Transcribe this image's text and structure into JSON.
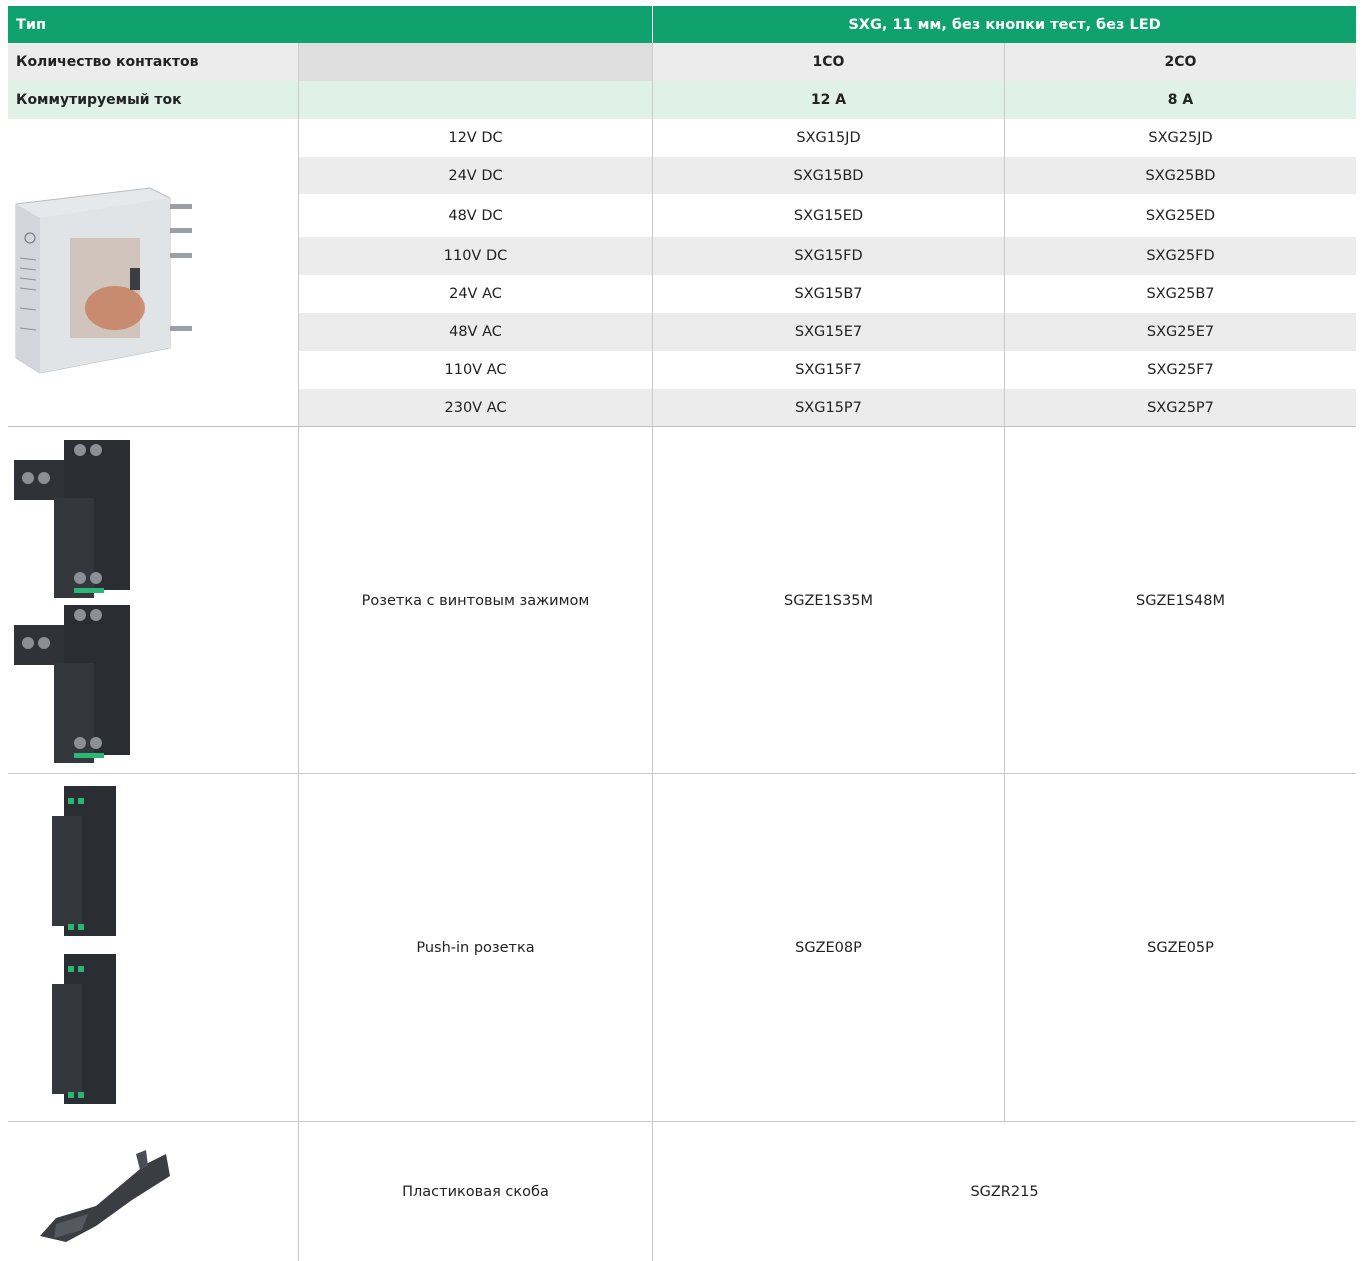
{
  "header": {
    "type_label": "Тип",
    "series_title": "SXG, 11 мм, без кнопки тест, без LED"
  },
  "contacts_row": {
    "label": "Количество контактов",
    "col1": "1CO",
    "col2": "2CO"
  },
  "current_row": {
    "label": "Коммутируемый ток",
    "col1": "12 А",
    "col2": "8 А"
  },
  "relay_rows": [
    {
      "voltage": "12V DC",
      "code_1co": "SXG15JD",
      "code_2co": "SXG25JD"
    },
    {
      "voltage": "24V DC",
      "code_1co": "SXG15BD",
      "code_2co": "SXG25BD"
    },
    {
      "voltage": "48V DC",
      "code_1co": "SXG15ED",
      "code_2co": "SXG25ED"
    },
    {
      "voltage": "110V DC",
      "code_1co": "SXG15FD",
      "code_2co": "SXG25FD"
    },
    {
      "voltage": "24V AC",
      "code_1co": "SXG15B7",
      "code_2co": "SXG25B7"
    },
    {
      "voltage": "48V AC",
      "code_1co": "SXG15E7",
      "code_2co": "SXG25E7"
    },
    {
      "voltage": "110V AC",
      "code_1co": "SXG15F7",
      "code_2co": "SXG25F7"
    },
    {
      "voltage": "230V AC",
      "code_1co": "SXG15P7",
      "code_2co": "SXG25P7"
    }
  ],
  "accessories": [
    {
      "name": "Розетка с винтовым зажимом",
      "code_1co": "SGZE1S35M",
      "code_2co": "SGZE1S48M"
    },
    {
      "name": "Push-in розетка",
      "code_1co": "SGZE08P",
      "code_2co": "SGZE05P"
    },
    {
      "name": "Пластиковая скоба",
      "code_all": "SGZR215"
    }
  ],
  "colors": {
    "header_bg": "#0fa16e",
    "row_gray": "#ececec",
    "row_mint": "#e0f1e8",
    "grid": "#c9c9c9"
  },
  "images": [
    "relay-photo",
    "screw-socket-photo",
    "push-in-socket-photo",
    "plastic-clip-photo"
  ]
}
